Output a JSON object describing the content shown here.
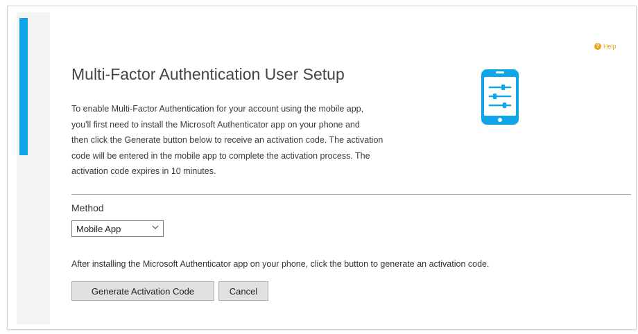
{
  "colors": {
    "accent": "#0ea5e9",
    "help": "#e8a31c",
    "button_bg": "#e1e1e1"
  },
  "help": {
    "label": "Help",
    "icon": "help-circle-icon"
  },
  "page": {
    "title": "Multi-Factor Authentication User Setup"
  },
  "illustration": {
    "icon": "mobile-phone-settings-icon"
  },
  "description": {
    "lines": [
      "To enable Multi-Factor Authentication for your account using the mobile app,",
      "you'll first need to install the Microsoft Authenticator app on your phone and",
      "then click the Generate button below to receive an activation code. The activation",
      "code will be entered in the mobile app to complete the activation process. The",
      "activation code expires in 10 minutes."
    ]
  },
  "method": {
    "label": "Method",
    "selected": "Mobile App",
    "dropdown_icon": "chevron-down-icon"
  },
  "instruction": "After installing the Microsoft Authenticator app on your phone, click the button to generate an activation code.",
  "buttons": {
    "generate": "Generate Activation Code",
    "cancel": "Cancel"
  }
}
